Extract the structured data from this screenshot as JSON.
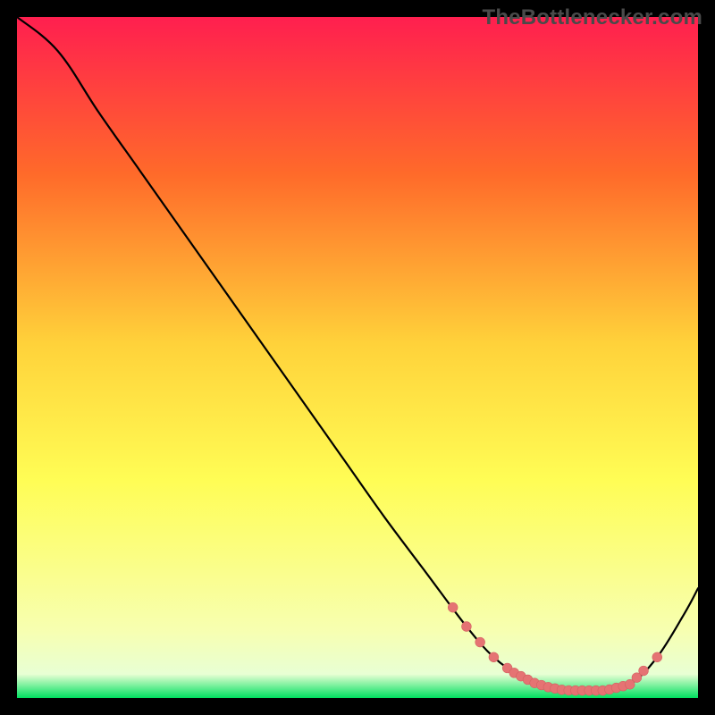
{
  "watermark": "TheBottlenecker.com",
  "colors": {
    "gradient_top": "#ff1f4f",
    "gradient_mid1": "#ff6a2a",
    "gradient_mid2": "#ffd23a",
    "gradient_mid3": "#fffd55",
    "gradient_low": "#f7ffb0",
    "gradient_bottom": "#00e060",
    "line": "#000000",
    "marker_fill": "#e57373",
    "marker_stroke": "#d46262"
  },
  "chart_data": {
    "type": "line",
    "title": "",
    "xlabel": "",
    "ylabel": "",
    "xlim": [
      0,
      100
    ],
    "ylim": [
      0,
      100
    ],
    "series": [
      {
        "name": "curve",
        "x": [
          0,
          6,
          12,
          18,
          24,
          30,
          36,
          42,
          48,
          54,
          60,
          66,
          70,
          74,
          78,
          82,
          86,
          90,
          94,
          98,
          100
        ],
        "y": [
          100,
          95,
          86,
          77.5,
          69,
          60.5,
          52,
          43.5,
          35,
          26.5,
          18.5,
          10.5,
          6,
          3.2,
          1.6,
          1.1,
          1.1,
          2.0,
          6.0,
          12.4,
          16.1
        ]
      }
    ],
    "markers": {
      "name": "highlight-dots",
      "x": [
        64,
        66,
        68,
        70,
        72,
        73,
        74,
        75,
        76,
        77,
        78,
        79,
        80,
        81,
        82,
        83,
        84,
        85,
        86,
        87,
        88,
        89,
        90,
        91,
        92,
        94
      ],
      "y": [
        13.3,
        10.5,
        8.2,
        6.0,
        4.4,
        3.7,
        3.2,
        2.7,
        2.2,
        1.9,
        1.6,
        1.4,
        1.2,
        1.12,
        1.1,
        1.1,
        1.1,
        1.1,
        1.1,
        1.25,
        1.5,
        1.75,
        2.0,
        3.0,
        4.0,
        6.0
      ]
    }
  }
}
